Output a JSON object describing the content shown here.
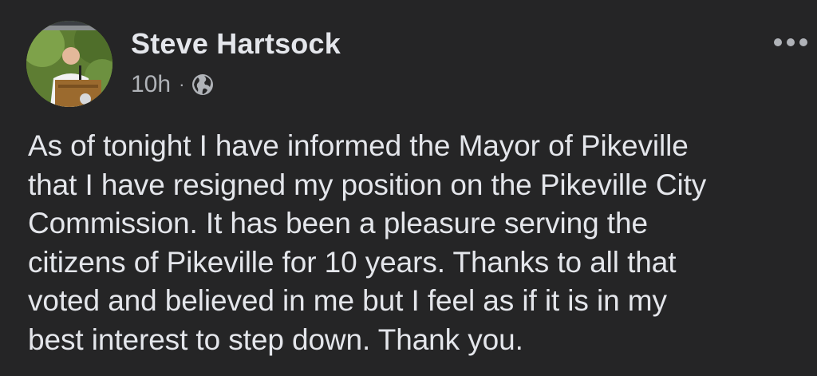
{
  "post": {
    "author": "Steve Hartsock",
    "timestamp": "10h",
    "separator": "·",
    "audience_icon": "globe-icon",
    "more_icon": "more-options-icon",
    "text_lines": [
      "As of tonight I have informed the Mayor of Pikeville",
      "that I have resigned my position on the Pikeville City",
      "Commission. It has been a pleasure serving the",
      "citizens of Pikeville for 10 years. Thanks to all that",
      "voted and believed in me but I feel as if it is in my",
      "best interest to step down. Thank you."
    ]
  },
  "colors": {
    "background": "#252526",
    "primary_text": "#e4e6eb",
    "secondary_text": "#b0b3b8"
  }
}
